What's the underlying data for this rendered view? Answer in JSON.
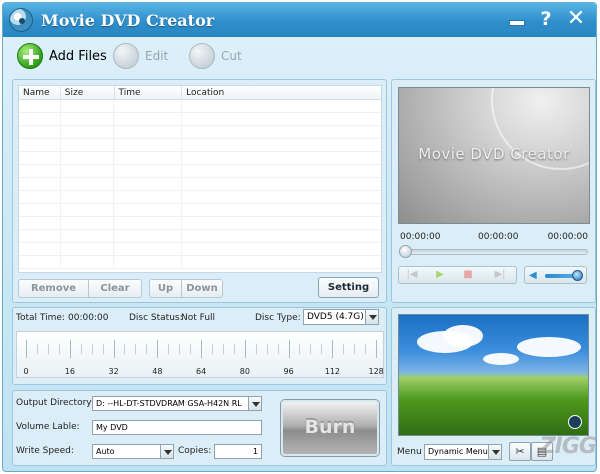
{
  "window": {
    "title": "Movie DVD Creator"
  },
  "titlebar": {
    "help_label": "?",
    "close_label": "✕"
  },
  "toolbar": {
    "add_label": "Add Files",
    "edit_label": "Edit",
    "cut_label": "Cut"
  },
  "file_table": {
    "columns": [
      "Name",
      "Size",
      "Time",
      "Location"
    ],
    "rows": []
  },
  "file_buttons": {
    "remove": "Remove",
    "clear": "Clear",
    "up": "Up",
    "down": "Down",
    "setting": "Setting"
  },
  "preview": {
    "screen_text": "Movie DVD Creator",
    "current_time": "00:00:00",
    "middle_time": "00:00:00",
    "total_time": "00:00:00",
    "seek_fraction": 0,
    "volume_fraction": 1
  },
  "disc": {
    "total_time_label": "Total Time:",
    "total_time_value": "00:00:00",
    "status_label": "Disc Status:",
    "status_value": "Not Full",
    "type_label": "Disc Type:",
    "type_value": "DVD5 (4.7G)",
    "scale_labels": [
      "0",
      "16",
      "32",
      "48",
      "64",
      "80",
      "96",
      "112",
      "128"
    ]
  },
  "output": {
    "directory_label": "Output Directory:",
    "directory_value": "D:  --HL-DT-STDVDRAM GSA-H42N  RL",
    "volume_label": "Volume Lable:",
    "volume_value": "My DVD",
    "speed_label": "Write Speed:",
    "speed_value": "Auto",
    "copies_label": "Copies:",
    "copies_value": "1",
    "burn_label": "Burn"
  },
  "menu": {
    "label": "Menu",
    "value": "Dynamic Menu"
  },
  "watermark": {
    "text": "ZIGG"
  },
  "icons": {
    "app": "dvd-disc-icon",
    "minimize": "minimize-icon",
    "help": "help-icon",
    "close": "close-icon",
    "add": "add-plus-icon",
    "edit": "edit-icon",
    "cut": "cut-icon",
    "prev": "previous-icon",
    "play": "play-icon",
    "stop": "stop-icon",
    "next": "next-icon",
    "speaker": "speaker-icon",
    "dropdown": "chevron-down-icon",
    "settings": "tools-icon",
    "preview": "preview-icon"
  },
  "colors": {
    "titlebar": "#2e8fcb",
    "panel": "#dbeef8",
    "border": "#9cc6de",
    "add_green": "#2d9d18"
  }
}
